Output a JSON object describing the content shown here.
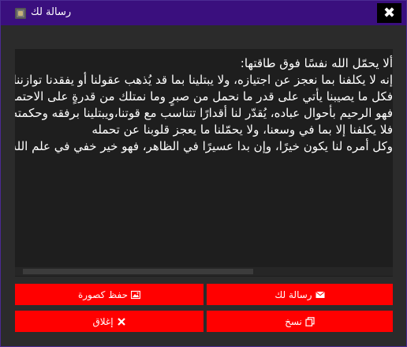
{
  "window": {
    "title": "رسالة لك",
    "close_glyph": "✖"
  },
  "message": {
    "lines": [
      "ألا يحمّل الله نفسًا فوق طاقتها:",
      "إنه لا يكلفنا بما نعجز عن اجتيازه، ولا يبتلينا بما قد يُذهب عقولنا أو يفقدنا توازننا",
      "فكل ما يصيبنا يأتي على قدر ما نحمل من صبرٍ وما نمتلك من قدرةٍ على الاحتمال",
      "فهو الرحيم بأحوال عباده، يُقدّر لنا أقدارًا تتناسب مع قوتنا،ويبتلينا برفقه وحكمته",
      "فلا يكلفنا إلا بما في وسعنا، ولا يحمّلنا ما يعجز قلوبنا عن تحمله",
      "وكل أمره لنا يكون خيرًا، وإن بدا عسيرًا في الظاهر، فهو خير خفي في علم الله وحكمته"
    ]
  },
  "buttons": {
    "save_image": "حفظ كصورة",
    "send_message": "رسالة لك",
    "close": "إغلاق",
    "copy": "نسخ"
  },
  "colors": {
    "titlebar": "#3a0f7e",
    "background": "#2b2b2b",
    "panel": "#1e1e1e",
    "button": "#ff0000"
  },
  "icons": {
    "save_image": "image-icon",
    "send_message": "envelope-icon",
    "close": "x-icon",
    "copy": "copy-icon"
  }
}
